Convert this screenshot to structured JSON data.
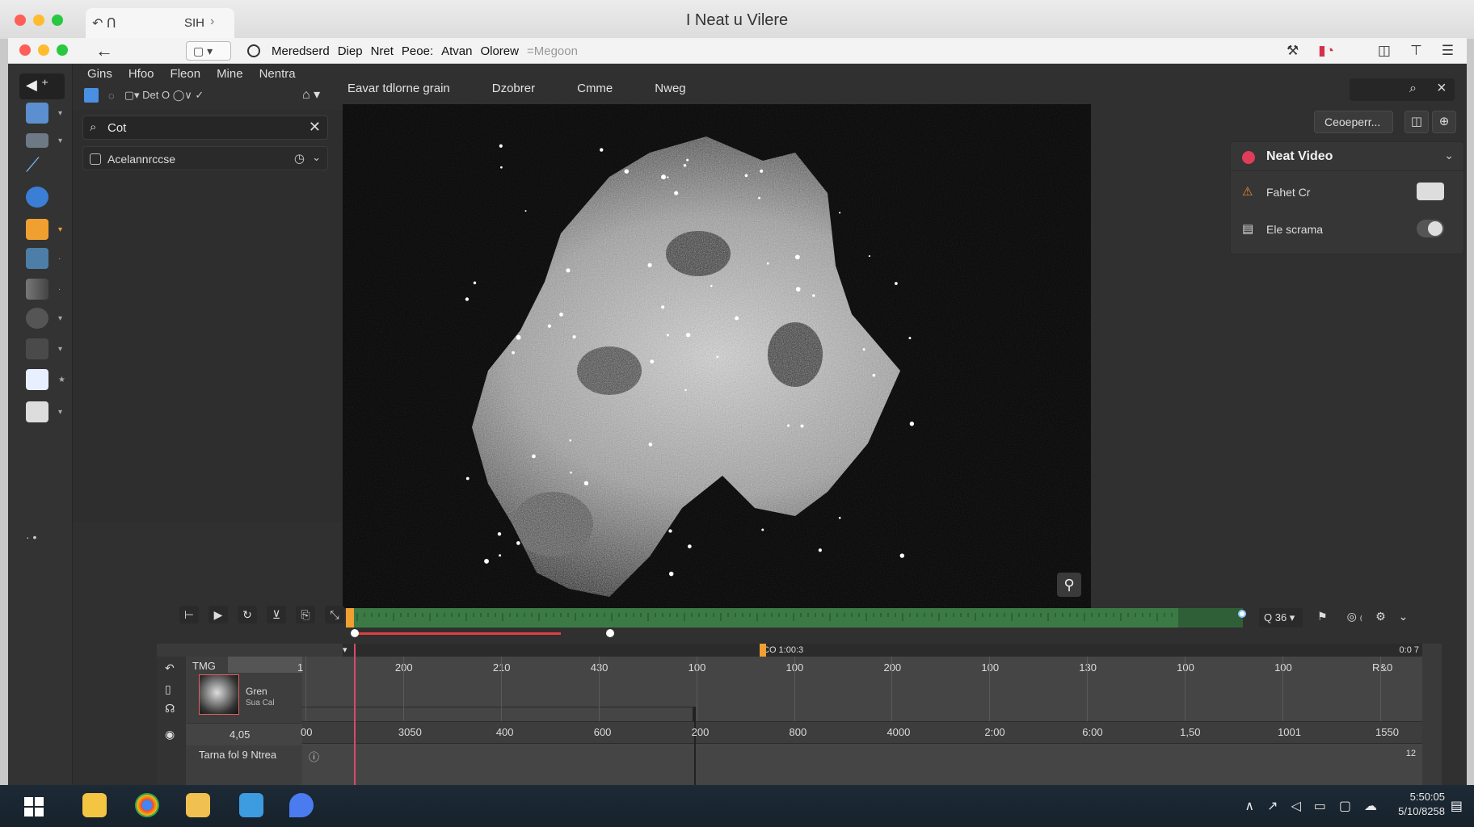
{
  "mac_window": {
    "tab_label": "SIH",
    "title": "I Neat u Vilere"
  },
  "browser_toolbar": {
    "box_text": "▢ ▾",
    "menu": [
      "Meredserd",
      "Diep",
      "Nret",
      "Peoe:",
      "Atvan",
      "Olorew"
    ],
    "menu_dim": "=Megoon"
  },
  "app": {
    "menubar": [
      "Gins",
      "Hfoo",
      "Fleon",
      "Mine",
      "Nentra"
    ],
    "minibar_text": "▢▾ Det  O ◯∨  ✓",
    "left_panel": {
      "search_value": "Cot",
      "row_label": "Acelannrccse"
    },
    "center_tabs": [
      "Eavar tdlorne grain",
      "Dzobrer",
      "Cmme",
      "Nweg"
    ],
    "right_panel": {
      "button_label": "Ceoeperr...",
      "card_title": "Neat Video",
      "rows": [
        {
          "label": "Fahet Cr",
          "icon": "warning-icon"
        },
        {
          "label": "Ele scrama",
          "icon": "file-icon"
        }
      ]
    },
    "transport": {
      "zoom_label": "Q 36 ▾"
    },
    "timeline": {
      "track_label": "TMG",
      "clip_label": "Gren",
      "clip_sub": "Sua  Cal",
      "ruler_top": [
        "1",
        "200",
        "210",
        "430",
        "100",
        "100",
        "200",
        "100",
        "130",
        "100",
        "100",
        "R&0"
      ],
      "ruler_bottom": [
        "00",
        "3050",
        "400",
        "600",
        "200",
        "800",
        "4000",
        "2:00",
        "6:00",
        "1,50",
        "1001",
        "1550"
      ],
      "row_value": "4,05",
      "footer_label": "Tarna fol 9 Ntrea",
      "head_marker": "CO 1:00:3",
      "head_end": "0:0 7",
      "footer_right": "12"
    }
  },
  "taskbar": {
    "time": "5:50:05",
    "date": "5/10/8258"
  },
  "colors": {
    "accent_green": "#3c7a45",
    "accent_red": "#e23c5b",
    "playhead": "#d84a6a"
  }
}
